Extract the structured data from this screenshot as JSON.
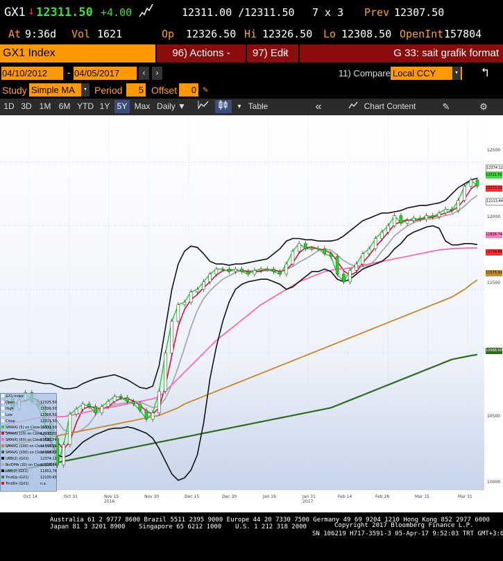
{
  "quote": {
    "ticker": "GX1",
    "last": "12311.50",
    "change": "+4.00",
    "bid_ask": "12311.00 /12311.50",
    "size": "7 x 3",
    "prev_label": "Prev",
    "prev": "12307.50",
    "at_label": "At",
    "time": "9:36d",
    "vol_label": "Vol",
    "vol": "1621",
    "op_label": "Op",
    "op": "12326.50",
    "hi_label": "Hi",
    "hi": "12326.50",
    "lo_label": "Lo",
    "lo": "12308.50",
    "oi_label": "OpenInt",
    "oi": "157804"
  },
  "menu": {
    "security": "GX1 Index",
    "actions": "96) Actions -",
    "edit": "97) Edit",
    "title": "G 33: sait grafik format"
  },
  "controls": {
    "start_date": "04/10/2012",
    "dash": "-",
    "end_date": "04/05/2017",
    "compare_label": "11) Compare",
    "compare_value": "Local CCY",
    "study_label": "Study",
    "study_value": "Simple MA",
    "period_label": "Period",
    "period_value": "5",
    "offset_label": "Offset",
    "offset_value": "0"
  },
  "toolbar": {
    "ranges": [
      "1D",
      "3D",
      "1M",
      "6M",
      "YTD",
      "1Y",
      "5Y",
      "Max"
    ],
    "selected": "5Y",
    "freq": "Daily ▼",
    "table": "Table",
    "chart_content": "Chart Content"
  },
  "chart_data": {
    "type": "line",
    "y_ticks": [
      "12500",
      "12000",
      "11500",
      "11000",
      "10500",
      "10000"
    ],
    "x_ticks": [
      "Oct 14",
      "Oct 31",
      "Nov 15\n2016",
      "Nov 30",
      "Dec 15",
      "Dec 30",
      "Jan 16",
      "Jan 31\n2017",
      "Feb 14",
      "Feb 28",
      "Mar 15",
      "Mar 31"
    ],
    "ylim": [
      9950,
      12650
    ],
    "price_tags": [
      {
        "value": "12374.12",
        "color": "#ffffff"
      },
      {
        "value": "12311.50",
        "color": "#3ddc3d"
      },
      {
        "value": "12213.03",
        "color": "#ff3030"
      },
      {
        "value": "12113.44",
        "color": "#ffffff"
      },
      {
        "value": "11826.74",
        "color": "#ff80c0"
      },
      {
        "value": "11739.86",
        "color": "#ff3030"
      },
      {
        "value": "11575.91",
        "color": "#cc8a2a"
      },
      {
        "value": "10988.60",
        "color": "#2a6a1a"
      }
    ],
    "legend": [
      "GX1 Index",
      "Open",
      "High",
      "Low",
      "Close",
      "SMAVG (5) on Close (GX1)",
      "SMAVG (10) on Close (GX1)",
      "SMAVG (60) on Close (GX1)",
      "SMAVG (100) on Close (GX1)",
      "SMAVG (200) on Close (GX1)",
      "UBB(2) (GX1)",
      "BolDMA (20) on Close (GX1)",
      "LBB(2) (GX1)",
      "TrndUp (GX1)",
      "TrndDn (GX1)"
    ],
    "legend_values": [
      "",
      "12325.50",
      "12326.50",
      "12308.50",
      "12311.50",
      "12311.50",
      "12213.03",
      "11826.74",
      "11575.91",
      "10988.60",
      "12374.12",
      "12113.44",
      "11852.76",
      "12130.65",
      "n.a."
    ],
    "series": [
      {
        "name": "Close",
        "values": [
          10600,
          10650,
          10560,
          10630,
          10690,
          10620,
          10580,
          10450,
          10330,
          10120,
          10280,
          10520,
          10560,
          10600,
          10580,
          10530,
          10580,
          10620,
          10660,
          10650,
          10620,
          10600,
          10550,
          10480,
          10530,
          10700,
          11000,
          11250,
          11380,
          11400,
          11480,
          11500,
          11560,
          11620,
          11660,
          11660,
          11640,
          11660,
          11640,
          11620,
          11650,
          11660,
          11660,
          11640,
          11620,
          11700,
          11800,
          11860,
          11820,
          11820,
          11820,
          11780,
          11760,
          11620,
          11560,
          11650,
          11700,
          11780,
          11820,
          11900,
          11950,
          12000,
          12080,
          12020,
          12040,
          12060,
          12050,
          12080,
          12070,
          12100,
          12130,
          12120,
          12200,
          12310,
          12360,
          12311
        ]
      },
      {
        "name": "SMAVG (60)",
        "values": [
          10420,
          10440,
          10450,
          10460,
          10470,
          10480,
          10490,
          10500,
          10500,
          10500,
          10500,
          10510,
          10520,
          10530,
          10540,
          10550,
          10560,
          10570,
          10580,
          10590,
          10600,
          10610,
          10620,
          10630,
          10640,
          10660,
          10700,
          10750,
          10800,
          10850,
          10900,
          10950,
          11000,
          11050,
          11100,
          11140,
          11180,
          11220,
          11260,
          11300,
          11340,
          11380,
          11410,
          11440,
          11470,
          11500,
          11530,
          11560,
          11580,
          11600,
          11620,
          11640,
          11650,
          11660,
          11660,
          11670,
          11680,
          11690,
          11700,
          11710,
          11720,
          11730,
          11740,
          11750,
          11760,
          11770,
          11780,
          11790,
          11800,
          11810,
          11815,
          11820,
          11822,
          11824,
          11825,
          11826
        ]
      },
      {
        "name": "SMAVG (100)",
        "values": [
          10260,
          10270,
          10280,
          10290,
          10300,
          10310,
          10320,
          10330,
          10340,
          10350,
          10360,
          10370,
          10380,
          10390,
          10400,
          10410,
          10420,
          10430,
          10440,
          10450,
          10460,
          10470,
          10480,
          10490,
          10500,
          10510,
          10530,
          10550,
          10570,
          10600,
          10620,
          10640,
          10660,
          10680,
          10700,
          10720,
          10740,
          10760,
          10780,
          10800,
          10820,
          10840,
          10860,
          10880,
          10900,
          10920,
          10940,
          10960,
          10980,
          11000,
          11020,
          11040,
          11060,
          11080,
          11100,
          11120,
          11140,
          11160,
          11180,
          11200,
          11220,
          11240,
          11260,
          11280,
          11300,
          11320,
          11340,
          11360,
          11380,
          11400,
          11420,
          11440,
          11470,
          11500,
          11540,
          11575
        ]
      },
      {
        "name": "SMAVG (200)",
        "values": [
          10070,
          10075,
          10080,
          10085,
          10090,
          10100,
          10110,
          10120,
          10130,
          10140,
          10150,
          10160,
          10170,
          10180,
          10190,
          10200,
          10210,
          10220,
          10230,
          10240,
          10250,
          10260,
          10270,
          10280,
          10290,
          10300,
          10310,
          10320,
          10330,
          10340,
          10350,
          10360,
          10370,
          10380,
          10390,
          10400,
          10410,
          10420,
          10430,
          10440,
          10450,
          10460,
          10470,
          10480,
          10490,
          10500,
          10510,
          10520,
          10530,
          10540,
          10550,
          10560,
          10570,
          10590,
          10610,
          10630,
          10650,
          10670,
          10690,
          10710,
          10730,
          10750,
          10770,
          10790,
          10810,
          10830,
          10850,
          10870,
          10890,
          10910,
          10930,
          10950,
          10960,
          10970,
          10980,
          10988
        ]
      },
      {
        "name": "UBB(2)",
        "values": [
          10780,
          10790,
          10800,
          10790,
          10790,
          10780,
          10770,
          10760,
          10760,
          10740,
          10720,
          10720,
          10730,
          10760,
          10780,
          10800,
          10810,
          10820,
          10830,
          10810,
          10790,
          10760,
          10730,
          10720,
          10740,
          10900,
          11200,
          11500,
          11700,
          11800,
          11840,
          11830,
          11780,
          11720,
          11700,
          11700,
          11690,
          11700,
          11700,
          11710,
          11720,
          11730,
          11740,
          11780,
          11820,
          11880,
          11900,
          11900,
          11890,
          11890,
          11880,
          11880,
          11880,
          11890,
          11920,
          11960,
          12000,
          12040,
          12060,
          12080,
          12100,
          12100,
          12110,
          12120,
          12140,
          12150,
          12160,
          12160,
          12170,
          12180,
          12200,
          12250,
          12300,
          12330,
          12360,
          12374
        ]
      },
      {
        "name": "LBB(2)",
        "values": [
          10380,
          10380,
          10370,
          10380,
          10390,
          10400,
          10380,
          10350,
          10300,
          10200,
          10180,
          10200,
          10250,
          10300,
          10330,
          10360,
          10380,
          10400,
          10410,
          10410,
          10420,
          10410,
          10390,
          10370,
          10330,
          10250,
          10150,
          10050,
          10000,
          10020,
          10080,
          10200,
          10450,
          10800,
          11050,
          11250,
          11400,
          11500,
          11540,
          11560,
          11570,
          11580,
          11580,
          11560,
          11540,
          11500,
          11520,
          11560,
          11600,
          11640,
          11640,
          11660,
          11640,
          11580,
          11560,
          11580,
          11620,
          11660,
          11680,
          11700,
          11720,
          11760,
          11820,
          11860,
          11920,
          11950,
          11970,
          11990,
          12000,
          11980,
          11880,
          11850,
          11850,
          11860,
          11860,
          11852
        ]
      }
    ]
  },
  "footer": {
    "line1": "Australia 61 2 9777 8600 Brazil 5511 2395 9000 Europe 44 20 7330 7500 Germany 49 69 9204 1210 Hong Kong 852 2977 6000",
    "line2a": "Japan 81 3 3201 8900",
    "line2b": "Singapore 65 6212 1000",
    "line2c": "U.S. 1 212 318 2000",
    "line2d": "Copyright 2017 Bloomberg Finance L.P.",
    "line3": "SN 106219 H717-3591-3 05-Apr-17  9:52:03 TRT  GMT+3:00"
  }
}
